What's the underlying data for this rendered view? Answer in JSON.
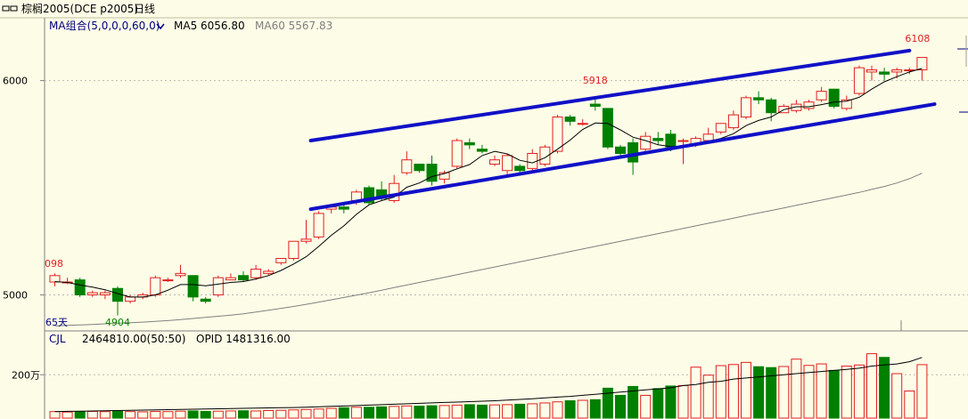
{
  "title_bar": {
    "icon": "chart-switch-icon",
    "symbol": "棕榈2005(DCE p2005)",
    "period": "日线",
    "dropdown_icon": "chevron-down-icon"
  },
  "price_panel": {
    "indicator": "MA组合(5,0,0,0,60,0)",
    "ma5_label": "MA5 6056.80",
    "ma60_label": "MA60 5567.83",
    "y_ticks": [
      {
        "label": "6000",
        "value": 6000
      },
      {
        "label": "5000",
        "value": 5000
      }
    ],
    "annotations": {
      "left_value": "098",
      "low": "4904",
      "high_mid": "5918",
      "high_last": "6108",
      "days_left": "65天"
    }
  },
  "volume_panel": {
    "indicator": "CJL",
    "volume_label": "2464810.00(50:50)",
    "opid_label": "OPID 1481316.00",
    "y_ticks": [
      {
        "label": "200万",
        "value": 2000000
      }
    ]
  },
  "colors": {
    "background": "#fdfde7",
    "up": "#e02020",
    "down": "#008000",
    "ma5": "#000000",
    "ma60": "#808080",
    "channel": "#1010c8",
    "axis_text": "#000080"
  },
  "chart_data": {
    "type": "candlestick",
    "x_count": 70,
    "ylim": [
      4840,
      6210
    ],
    "volume_ylim": [
      0,
      3200000
    ],
    "candles": [
      [
        5060,
        5090,
        5040,
        5100
      ],
      [
        5060,
        5060,
        5050,
        5080
      ],
      [
        5070,
        5000,
        4990,
        5080
      ],
      [
        5000,
        5010,
        4990,
        5020
      ],
      [
        5000,
        5010,
        4980,
        5020
      ],
      [
        5030,
        4970,
        4904,
        5040
      ],
      [
        4970,
        4990,
        4960,
        5000
      ],
      [
        4990,
        5000,
        4980,
        5010
      ],
      [
        5000,
        5080,
        4990,
        5090
      ],
      [
        5070,
        5070,
        5060,
        5080
      ],
      [
        5090,
        5100,
        5080,
        5140
      ],
      [
        5090,
        4990,
        4970,
        5090
      ],
      [
        4980,
        4970,
        4960,
        4990
      ],
      [
        5000,
        5080,
        4990,
        5090
      ],
      [
        5070,
        5080,
        5070,
        5100
      ],
      [
        5090,
        5070,
        5060,
        5110
      ],
      [
        5080,
        5120,
        5070,
        5140
      ],
      [
        5100,
        5110,
        5090,
        5120
      ],
      [
        5150,
        5170,
        5140,
        5170
      ],
      [
        5170,
        5250,
        5160,
        5250
      ],
      [
        5250,
        5260,
        5240,
        5350
      ],
      [
        5270,
        5380,
        5260,
        5390
      ],
      [
        5400,
        5410,
        5380,
        5410
      ],
      [
        5410,
        5400,
        5380,
        5430
      ],
      [
        5440,
        5480,
        5420,
        5490
      ],
      [
        5500,
        5430,
        5420,
        5510
      ],
      [
        5490,
        5450,
        5440,
        5530
      ],
      [
        5440,
        5520,
        5430,
        5560
      ],
      [
        5570,
        5630,
        5560,
        5670
      ],
      [
        5610,
        5580,
        5570,
        5610
      ],
      [
        5610,
        5530,
        5510,
        5650
      ],
      [
        5540,
        5570,
        5520,
        5580
      ],
      [
        5600,
        5720,
        5590,
        5730
      ],
      [
        5710,
        5700,
        5680,
        5730
      ],
      [
        5680,
        5670,
        5660,
        5700
      ],
      [
        5610,
        5630,
        5600,
        5650
      ],
      [
        5580,
        5650,
        5560,
        5660
      ],
      [
        5600,
        5580,
        5560,
        5610
      ],
      [
        5590,
        5660,
        5580,
        5680
      ],
      [
        5610,
        5690,
        5600,
        5700
      ],
      [
        5670,
        5830,
        5660,
        5840
      ],
      [
        5830,
        5810,
        5790,
        5840
      ],
      [
        5800,
        5800,
        5790,
        5820
      ],
      [
        5890,
        5880,
        5860,
        5918
      ],
      [
        5870,
        5690,
        5680,
        5870
      ],
      [
        5690,
        5660,
        5650,
        5700
      ],
      [
        5710,
        5620,
        5560,
        5730
      ],
      [
        5680,
        5740,
        5670,
        5760
      ],
      [
        5730,
        5720,
        5700,
        5760
      ],
      [
        5750,
        5690,
        5670,
        5770
      ],
      [
        5720,
        5720,
        5610,
        5730
      ],
      [
        5700,
        5730,
        5690,
        5740
      ],
      [
        5720,
        5750,
        5710,
        5780
      ],
      [
        5760,
        5800,
        5750,
        5800
      ],
      [
        5780,
        5840,
        5770,
        5860
      ],
      [
        5830,
        5920,
        5820,
        5930
      ],
      [
        5920,
        5910,
        5890,
        5950
      ],
      [
        5910,
        5850,
        5810,
        5920
      ],
      [
        5850,
        5880,
        5850,
        5890
      ],
      [
        5860,
        5890,
        5850,
        5910
      ],
      [
        5870,
        5900,
        5860,
        5910
      ],
      [
        5910,
        5950,
        5900,
        5970
      ],
      [
        5960,
        5880,
        5870,
        5960
      ],
      [
        5870,
        5910,
        5860,
        5930
      ],
      [
        5940,
        6060,
        5930,
        6070
      ],
      [
        6040,
        6050,
        6000,
        6070
      ],
      [
        6040,
        6030,
        6000,
        6060
      ],
      [
        6040,
        6050,
        6010,
        6060
      ],
      [
        6050,
        6050,
        6030,
        6060
      ],
      [
        6050,
        6108,
        6000,
        6108
      ]
    ],
    "ma5": [
      5062,
      5058,
      5046,
      5036,
      5024,
      5006,
      4990,
      4990,
      5000,
      5022,
      5048,
      5048,
      5042,
      5050,
      5058,
      5062,
      5074,
      5090,
      5114,
      5144,
      5178,
      5226,
      5278,
      5322,
      5376,
      5420,
      5440,
      5456,
      5502,
      5522,
      5552,
      5566,
      5588,
      5608,
      5650,
      5670,
      5658,
      5628,
      5616,
      5640,
      5680,
      5722,
      5772,
      5802,
      5800,
      5770,
      5736,
      5720,
      5700,
      5692,
      5694,
      5704,
      5716,
      5730,
      5752,
      5790,
      5814,
      5830,
      5864,
      5878,
      5878,
      5888,
      5900,
      5904,
      5922,
      5960,
      5994,
      6018,
      6040,
      6056.8
    ],
    "ma60": [
      4855,
      4858,
      4860,
      4862,
      4865,
      4868,
      4870,
      4873,
      4876,
      4880,
      4885,
      4890,
      4895,
      4900,
      4905,
      4912,
      4920,
      4928,
      4937,
      4946,
      4956,
      4966,
      4977,
      4988,
      4999,
      5010,
      5022,
      5034,
      5046,
      5058,
      5070,
      5082,
      5094,
      5106,
      5118,
      5130,
      5142,
      5154,
      5166,
      5178,
      5190,
      5202,
      5214,
      5226,
      5238,
      5250,
      5262,
      5274,
      5286,
      5298,
      5310,
      5322,
      5334,
      5346,
      5358,
      5370,
      5382,
      5394,
      5406,
      5418,
      5430,
      5442,
      5454,
      5466,
      5478,
      5492,
      5506,
      5522,
      5542,
      5567.83
    ],
    "volume": [
      300000,
      280000,
      290000,
      310000,
      300000,
      320000,
      300000,
      290000,
      310000,
      300000,
      320000,
      330000,
      310000,
      320000,
      330000,
      340000,
      330000,
      350000,
      360000,
      380000,
      400000,
      420000,
      450000,
      480000,
      500000,
      500000,
      520000,
      540000,
      560000,
      550000,
      570000,
      580000,
      600000,
      620000,
      600000,
      610000,
      620000,
      640000,
      660000,
      700000,
      750000,
      800000,
      820000,
      850000,
      1380000,
      1050000,
      1460000,
      1050000,
      1360000,
      1480000,
      1500000,
      2350000,
      1980000,
      2420000,
      2470000,
      2570000,
      2370000,
      2330000,
      2380000,
      2720000,
      2430000,
      2500000,
      2200000,
      2400000,
      2450000,
      2970000,
      2800000,
      2050000,
      1250000,
      2464810
    ],
    "opid": [
      300000,
      310000,
      320000,
      330000,
      340000,
      350000,
      360000,
      370000,
      380000,
      390000,
      400000,
      410000,
      420000,
      430000,
      440000,
      450000,
      460000,
      470000,
      480000,
      490000,
      500000,
      520000,
      540000,
      560000,
      580000,
      600000,
      620000,
      640000,
      660000,
      680000,
      700000,
      720000,
      740000,
      760000,
      780000,
      800000,
      830000,
      860000,
      890000,
      930000,
      970000,
      1000000,
      1050000,
      1100000,
      1150000,
      1200000,
      1250000,
      1300000,
      1350000,
      1400000,
      1500000,
      1550000,
      1650000,
      1700000,
      1800000,
      1850000,
      1900000,
      1950000,
      2000000,
      2050000,
      2100000,
      2150000,
      2200000,
      2250000,
      2300000,
      2400000,
      2450000,
      2500000,
      2600000,
      2800000
    ],
    "channel_upper": [
      [
        21,
        5720
      ],
      [
        68,
        6140
      ]
    ],
    "channel_lower": [
      [
        21,
        5400
      ],
      [
        70,
        5890
      ]
    ]
  }
}
